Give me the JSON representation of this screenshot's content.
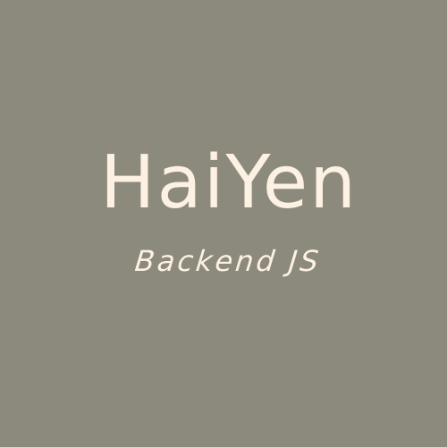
{
  "brand": {
    "title": "HaiYen",
    "subtitle": "Backend JS"
  },
  "colors": {
    "background": "#8c897d",
    "text": "#fcf1e2"
  }
}
